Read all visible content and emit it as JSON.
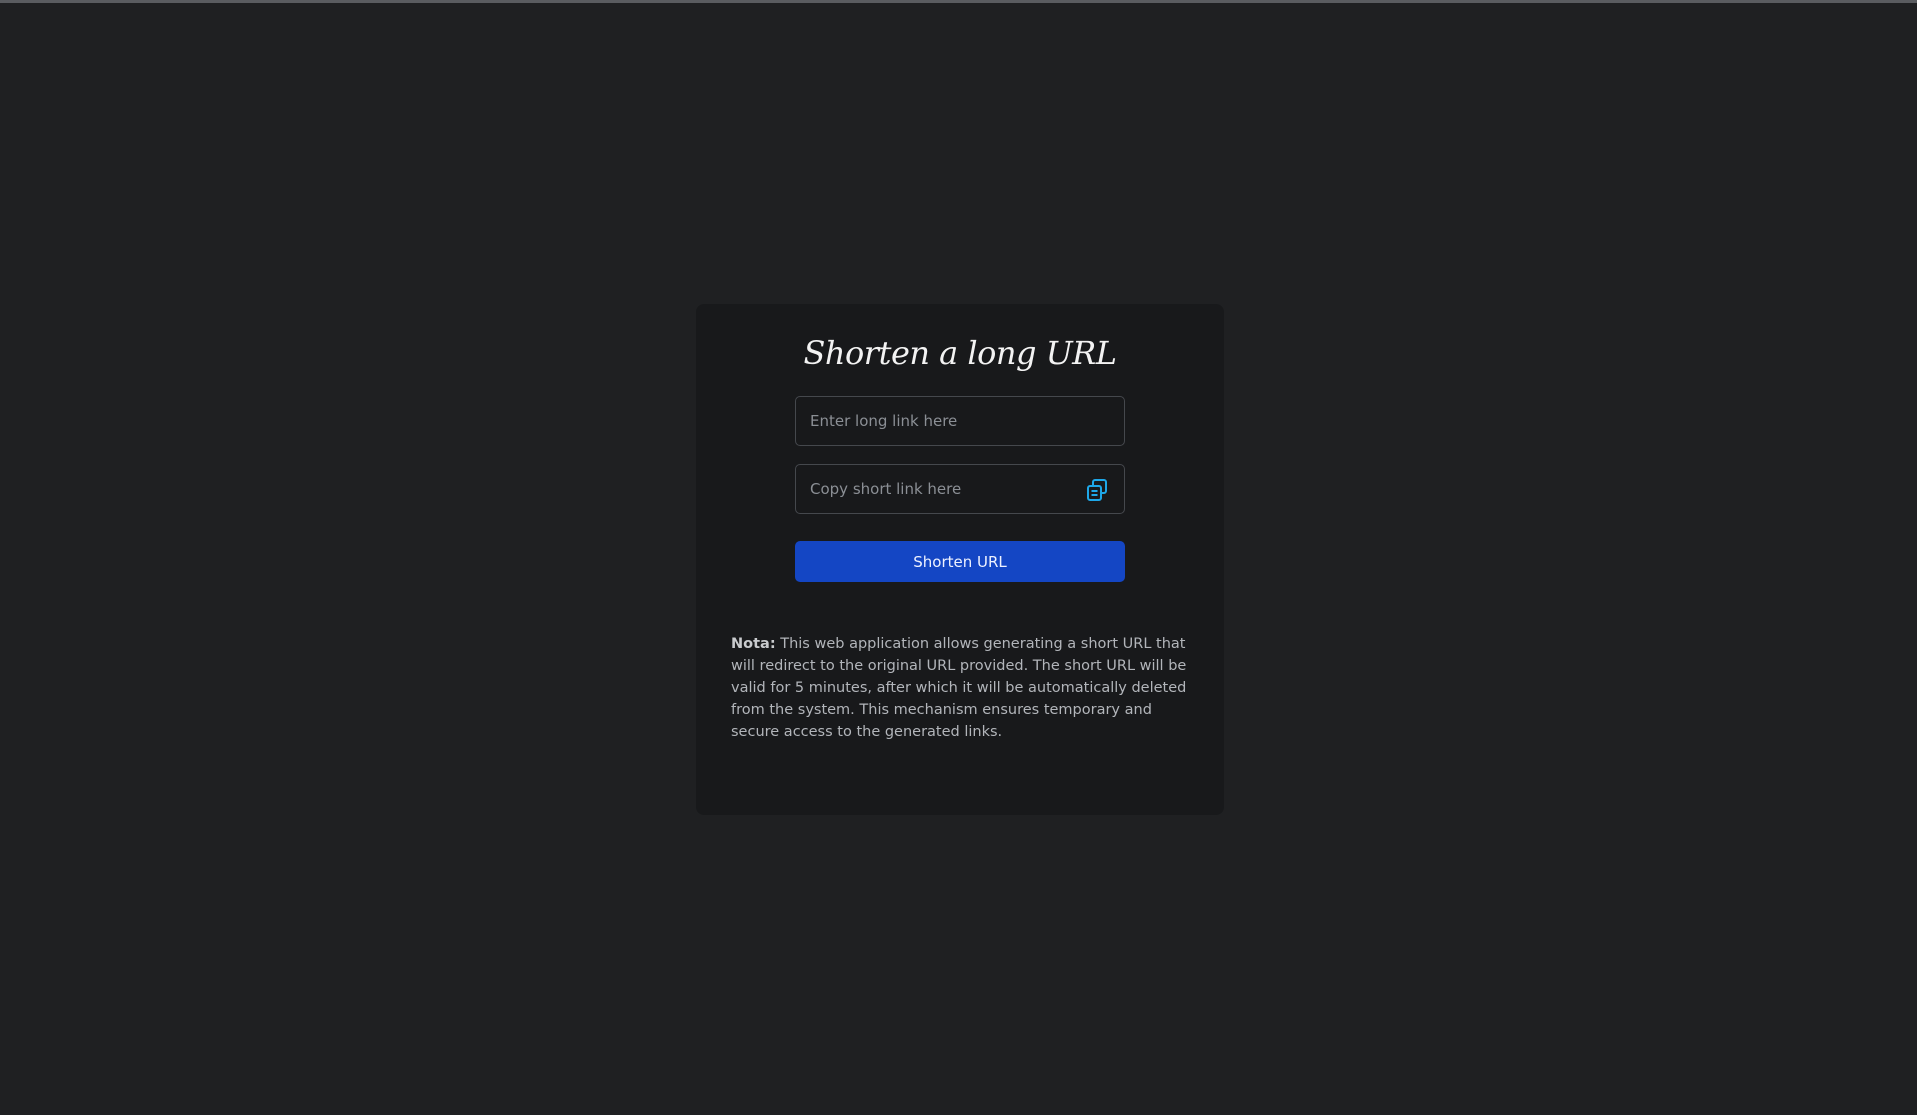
{
  "page": {
    "title": "Shorten a long URL"
  },
  "form": {
    "long_url": {
      "value": "",
      "placeholder": "Enter long link here"
    },
    "short_url": {
      "value": "",
      "placeholder": "Copy short link here",
      "copy_icon": "copy-icon"
    },
    "submit_label": "Shorten URL"
  },
  "note": {
    "label": "Nota:",
    "text": " This web application allows generating a short URL that will redirect to the original URL provided. The short URL will be valid for 5 minutes, after which it will be automatically deleted from the system. This mechanism ensures temporary and secure access to the generated links."
  },
  "colors": {
    "background": "#1f2022",
    "card": "#18191b",
    "accent": "#1446c4",
    "icon": "#1ea7e8"
  }
}
